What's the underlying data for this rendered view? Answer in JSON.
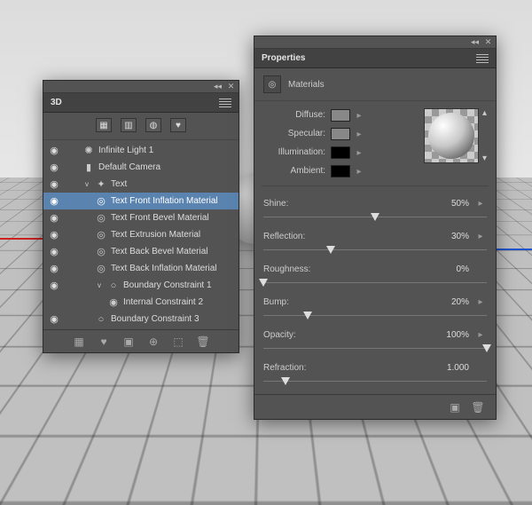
{
  "panel3D": {
    "title": "3D",
    "tree": [
      {
        "eye": true,
        "indent": 1,
        "icon": "✺",
        "label": "Infinite Light 1",
        "sel": false
      },
      {
        "eye": true,
        "indent": 1,
        "icon": "▮",
        "label": "Default Camera",
        "sel": false
      },
      {
        "eye": true,
        "indent": 1,
        "caret": "v",
        "icon": "✦",
        "label": "Text",
        "sel": false
      },
      {
        "eye": true,
        "indent": 2,
        "icon": "◎",
        "label": "Text Front Inflation Material",
        "sel": true
      },
      {
        "eye": true,
        "indent": 2,
        "icon": "◎",
        "label": "Text Front Bevel Material",
        "sel": false
      },
      {
        "eye": true,
        "indent": 2,
        "icon": "◎",
        "label": "Text Extrusion Material",
        "sel": false
      },
      {
        "eye": true,
        "indent": 2,
        "icon": "◎",
        "label": "Text Back Bevel Material",
        "sel": false
      },
      {
        "eye": true,
        "indent": 2,
        "icon": "◎",
        "label": "Text Back Inflation Material",
        "sel": false
      },
      {
        "eye": true,
        "indent": 2,
        "caret": "v",
        "icon": "○",
        "label": "Boundary Constraint 1",
        "sel": false
      },
      {
        "eye": false,
        "indent": 3,
        "icon": "◉",
        "label": "Internal Constraint 2",
        "sel": false
      },
      {
        "eye": true,
        "indent": 2,
        "icon": "○",
        "label": "Boundary Constraint 3",
        "sel": false
      }
    ]
  },
  "props": {
    "title": "Properties",
    "subhead": "Materials",
    "colorLabels": [
      "Diffuse:",
      "Specular:",
      "Illumination:",
      "Ambient:"
    ],
    "swatches": [
      "gray",
      "gray",
      "black",
      "black"
    ],
    "sliders": [
      {
        "label": "Shine:",
        "value": "50%",
        "pct": 50,
        "folder": true
      },
      {
        "label": "Reflection:",
        "value": "30%",
        "pct": 30,
        "folder": true
      },
      {
        "label": "Roughness:",
        "value": "0%",
        "pct": 0,
        "folder": false
      },
      {
        "label": "Bump:",
        "value": "20%",
        "pct": 20,
        "folder": true
      },
      {
        "label": "Opacity:",
        "value": "100%",
        "pct": 100,
        "folder": true
      },
      {
        "label": "Refraction:",
        "value": "1.000",
        "pct": 10,
        "folder": false
      }
    ]
  }
}
